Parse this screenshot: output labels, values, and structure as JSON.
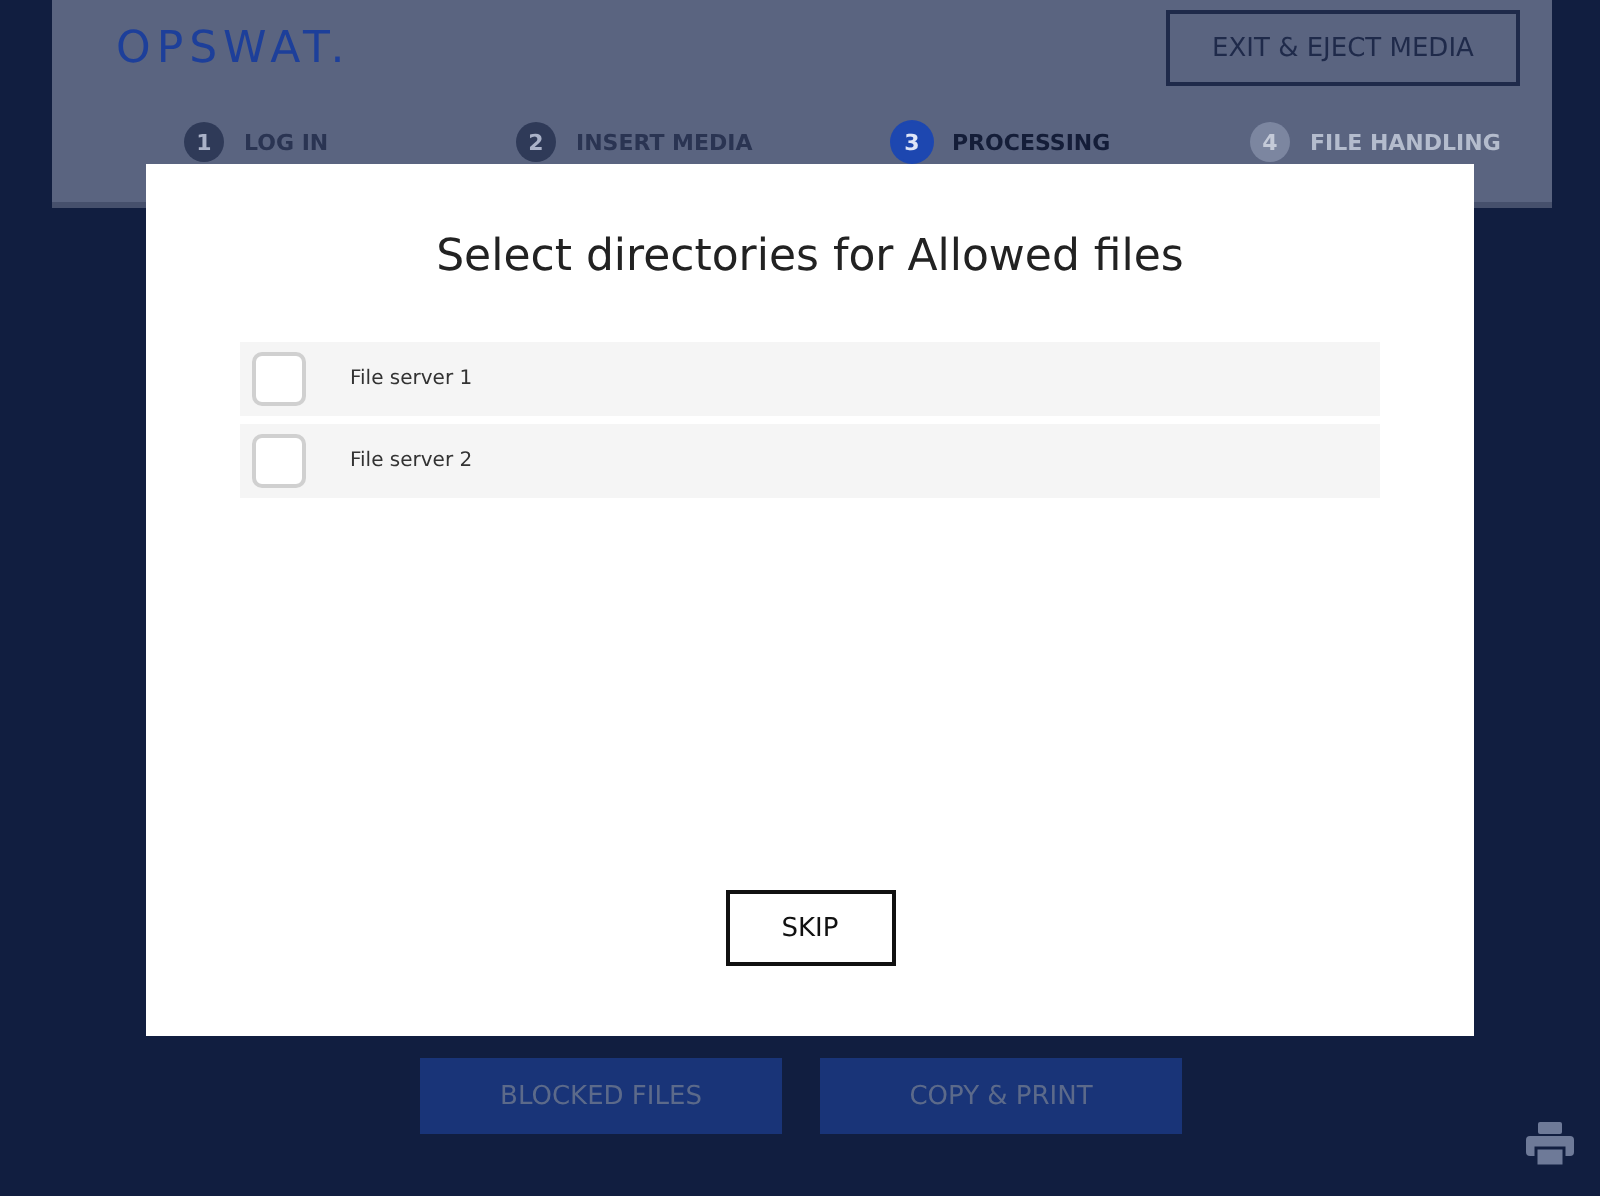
{
  "header": {
    "logo": "OPSWAT.",
    "exit_button": "EXIT & EJECT MEDIA",
    "steps": [
      {
        "number": "1",
        "label": "LOG IN",
        "selected": false,
        "disabled": false
      },
      {
        "number": "2",
        "label": "INSERT MEDIA",
        "selected": false,
        "disabled": false
      },
      {
        "number": "3",
        "label": "PROCESSING",
        "selected": true,
        "disabled": false
      },
      {
        "number": "4",
        "label": "FILE HANDLING",
        "selected": false,
        "disabled": true
      }
    ]
  },
  "actions": [
    "BLOCKED FILES",
    "COPY & PRINT"
  ],
  "dialog": {
    "title": "Select directories for Allowed files",
    "items": [
      {
        "label": "File server 1",
        "checked": false
      },
      {
        "label": "File server 2",
        "checked": false
      }
    ],
    "skip_button": "SKIP"
  }
}
